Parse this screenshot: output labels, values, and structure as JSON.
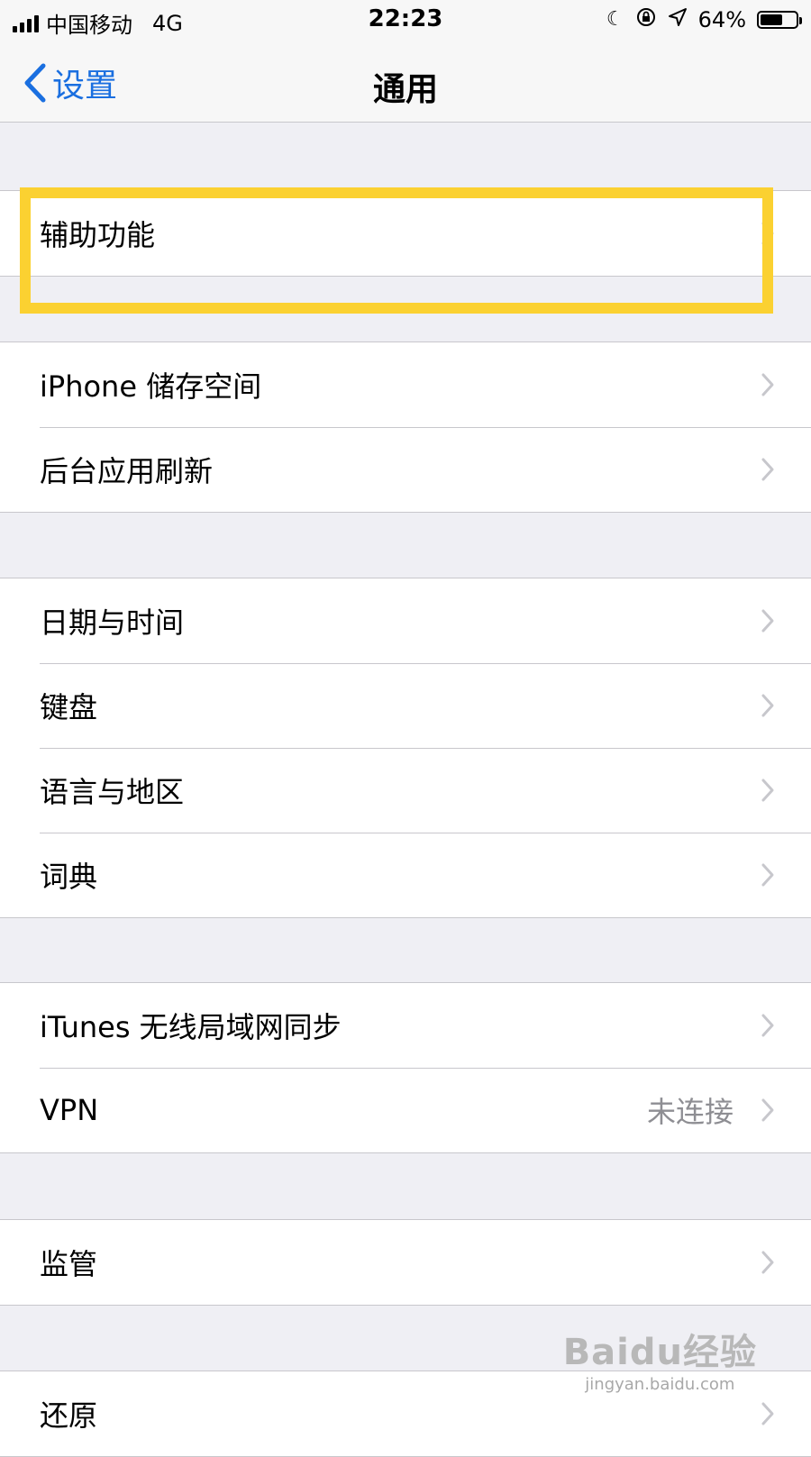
{
  "status_bar": {
    "carrier": "中国移动",
    "network": "4G",
    "time": "22:23",
    "battery_percent": "64%",
    "battery_level": 0.64
  },
  "nav": {
    "back_label": "设置",
    "title": "通用"
  },
  "groups": [
    {
      "items": [
        {
          "label": "辅助功能"
        }
      ]
    },
    {
      "items": [
        {
          "label": "iPhone 储存空间"
        },
        {
          "label": "后台应用刷新"
        }
      ]
    },
    {
      "items": [
        {
          "label": "日期与时间"
        },
        {
          "label": "键盘"
        },
        {
          "label": "语言与地区"
        },
        {
          "label": "词典"
        }
      ]
    },
    {
      "items": [
        {
          "label": "iTunes 无线局域网同步"
        },
        {
          "label": "VPN",
          "value": "未连接"
        }
      ]
    },
    {
      "items": [
        {
          "label": "监管"
        }
      ]
    },
    {
      "items": [
        {
          "label": "还原"
        }
      ]
    }
  ],
  "watermark": {
    "logo": "Baidu经验",
    "url": "jingyan.baidu.com"
  },
  "colors": {
    "accent": "#1a6fe0",
    "highlight": "#fbd131",
    "background": "#efeff4"
  }
}
